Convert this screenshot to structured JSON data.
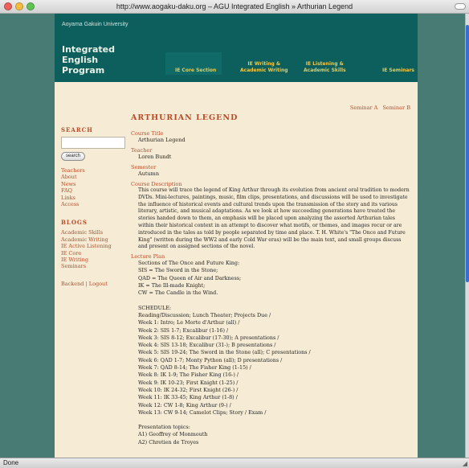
{
  "browser": {
    "title": "http://www.aogaku-daku.org – AGU Integrated English » Arthurian Legend",
    "status": "Done"
  },
  "header": {
    "university": "Aoyama Gakuin University",
    "program_lines": [
      "Integrated",
      "English",
      "Program"
    ],
    "nav": {
      "core": "IE Core Section",
      "writing_1": "IE Writing &",
      "writing_2": "Academic Writing",
      "listening_1": "IE Listening &",
      "listening_2": "Academic Skills",
      "seminars": "IE Seminars"
    }
  },
  "sidebar": {
    "search_heading": "SEARCH",
    "search_value": "",
    "search_button": "search",
    "links": [
      "Teachers",
      "About",
      "News",
      "FAQ",
      "Links",
      "Access"
    ],
    "blogs_heading": "BLOGS",
    "blog_links": [
      "Academic Skills",
      "Academic Writing",
      "IE Active Listening",
      "IE Core",
      "IE Writing",
      "Seminars"
    ],
    "backend": "Backend | Logout"
  },
  "seminar_links": {
    "a": "Seminar A",
    "b": "Seminar B"
  },
  "course": {
    "heading": "ARTHURIAN LEGEND",
    "title_label": "Course Title",
    "title": "Arthurian Legend",
    "teacher_label": "Teacher",
    "teacher": "Loren Bundt",
    "semester_label": "Semester",
    "semester": "Autumn",
    "description_label": "Course Description",
    "description": "This course will trace the legend of King Arthur through its evolution from ancient oral tradition to modern DVDs. Mini-lectures, paintings, music, film clips, presentations, and discussions will be used to investigate the influence of historical events and cultural trends upon the transmission of the story and its various literary, artistic, and musical adaptations. As we look at how succeeding generations have treated the stories handed down to them, an emphasis will be placed upon analyzing the assorted Arthurian tales within their historical context in an attempt to discover what motifs, or themes, and images recur or are introduced in the tales as told by people separated by time and place. T. H. White's \"The Once and Future King\" (written during the WW2 and early Cold War eras) will be the main text, and small groups discuss and present on assigned sections of the novel.",
    "plan_label": "Lecture Plan",
    "plan_sections": [
      "Sections of The Once and Future King:",
      "SIS = The Sword in the Stone;",
      "QAD = The Queen of Air and Darkness;",
      "IK = The Ill-made Knight;",
      "CW = The Candle in the Wind."
    ],
    "schedule_lines": [
      "SCHEDULE:",
      "Reading/Discussion; Lunch Theater; Projects Due /",
      "Week 1: Intro; Le Morte d'Arthur (all) /",
      "Week 2: SIS 1-7; Excalibur (1-16) /",
      "Week 3: SIS 8-12; Excalibur (17-30); A presentations /",
      "Week 4: SIS 13-18; Excalibur (31-); B presentations /",
      "Week 5: SIS 19-24; The Sword in the Stone (all); C presentations /",
      "Week 6: QAD 1-7; Monty Python (all); D presentations /",
      "Week 7: QAD 8-14; The Fisher King (1-15) /",
      "Week 8: IK 1-9; The Fisher King (16-) /",
      "Week 9: IK 10-23; First Knight (1-25) /",
      "Week 10: IK 24-32; First Knight (26-) /",
      "Week 11: IK 33-45; King Arthur (1-8) /",
      "Week 12: CW 1-8; King Arthur (9-) /",
      "Week 13: CW 9-14; Camelot Clips; Story / Exam /"
    ],
    "presentation_lines": [
      "Presentation topics:",
      "A1) Geoffrey of Monmouth",
      "A2) Chretien de Troyes"
    ]
  }
}
